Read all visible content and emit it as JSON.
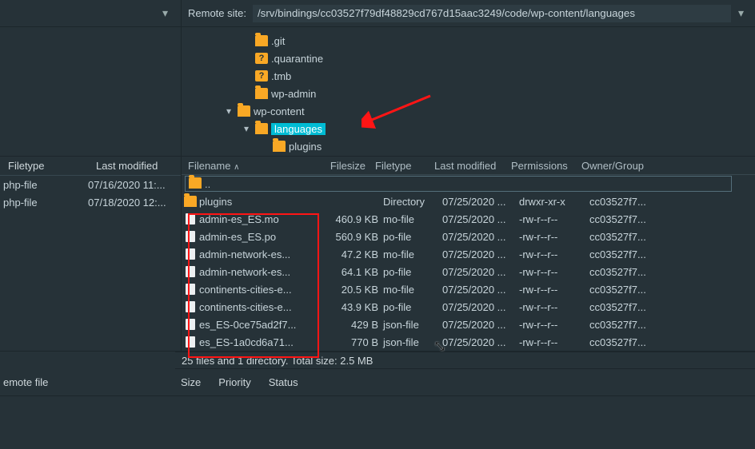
{
  "remote_site_label": "Remote site:",
  "remote_path": "/srv/bindings/cc03527f79df48829cd767d15aac3249/code/wp-content/languages",
  "tree": [
    {
      "icon": "folder",
      "label": ".git",
      "indent": 3
    },
    {
      "icon": "q",
      "label": ".quarantine",
      "indent": 3
    },
    {
      "icon": "q",
      "label": ".tmb",
      "indent": 3
    },
    {
      "icon": "folder",
      "label": "wp-admin",
      "indent": 3
    },
    {
      "icon": "folder",
      "label": "wp-content",
      "indent": 2,
      "expander": "▾"
    },
    {
      "icon": "folder",
      "label": "languages",
      "indent": 3,
      "expander": "▾",
      "highlighted": true
    },
    {
      "icon": "folder",
      "label": "plugins",
      "indent": 4
    }
  ],
  "left_headers": {
    "filetype": "Filetype",
    "modified": "Last modified"
  },
  "left_rows": [
    {
      "filetype": "php-file",
      "modified": "07/16/2020 11:..."
    },
    {
      "filetype": "php-file",
      "modified": "07/18/2020 12:..."
    }
  ],
  "right_headers": {
    "filename": "Filename",
    "filesize": "Filesize",
    "filetype": "Filetype",
    "modified": "Last modified",
    "permissions": "Permissions",
    "owner": "Owner/Group"
  },
  "updir_label": "..",
  "right_rows": [
    {
      "icon": "folder",
      "name": "plugins",
      "size": "",
      "type": "Directory",
      "mod": "07/25/2020 ...",
      "perm": "drwxr-xr-x",
      "own": "cc03527f7..."
    },
    {
      "icon": "file",
      "name": "admin-es_ES.mo",
      "size": "460.9 KB",
      "type": "mo-file",
      "mod": "07/25/2020 ...",
      "perm": "-rw-r--r--",
      "own": "cc03527f7..."
    },
    {
      "icon": "file",
      "name": "admin-es_ES.po",
      "size": "560.9 KB",
      "type": "po-file",
      "mod": "07/25/2020 ...",
      "perm": "-rw-r--r--",
      "own": "cc03527f7..."
    },
    {
      "icon": "file",
      "name": "admin-network-es...",
      "size": "47.2 KB",
      "type": "mo-file",
      "mod": "07/25/2020 ...",
      "perm": "-rw-r--r--",
      "own": "cc03527f7..."
    },
    {
      "icon": "file",
      "name": "admin-network-es...",
      "size": "64.1 KB",
      "type": "po-file",
      "mod": "07/25/2020 ...",
      "perm": "-rw-r--r--",
      "own": "cc03527f7..."
    },
    {
      "icon": "file",
      "name": "continents-cities-e...",
      "size": "20.5 KB",
      "type": "mo-file",
      "mod": "07/25/2020 ...",
      "perm": "-rw-r--r--",
      "own": "cc03527f7..."
    },
    {
      "icon": "file",
      "name": "continents-cities-e...",
      "size": "43.9 KB",
      "type": "po-file",
      "mod": "07/25/2020 ...",
      "perm": "-rw-r--r--",
      "own": "cc03527f7..."
    },
    {
      "icon": "file",
      "name": "es_ES-0ce75ad2f7...",
      "size": "429 B",
      "type": "json-file",
      "mod": "07/25/2020 ...",
      "perm": "-rw-r--r--",
      "own": "cc03527f7..."
    },
    {
      "icon": "file",
      "name": "es_ES-1a0cd6a71...",
      "size": "770 B",
      "type": "json-file",
      "mod": "07/25/2020 ...",
      "perm": "-rw-r--r--",
      "own": "cc03527f7..."
    }
  ],
  "status_summary": "25 files and 1 directory. Total size: 2.5 MB",
  "queue_headers": {
    "remote": "emote file",
    "size": "Size",
    "priority": "Priority",
    "status": "Status"
  }
}
